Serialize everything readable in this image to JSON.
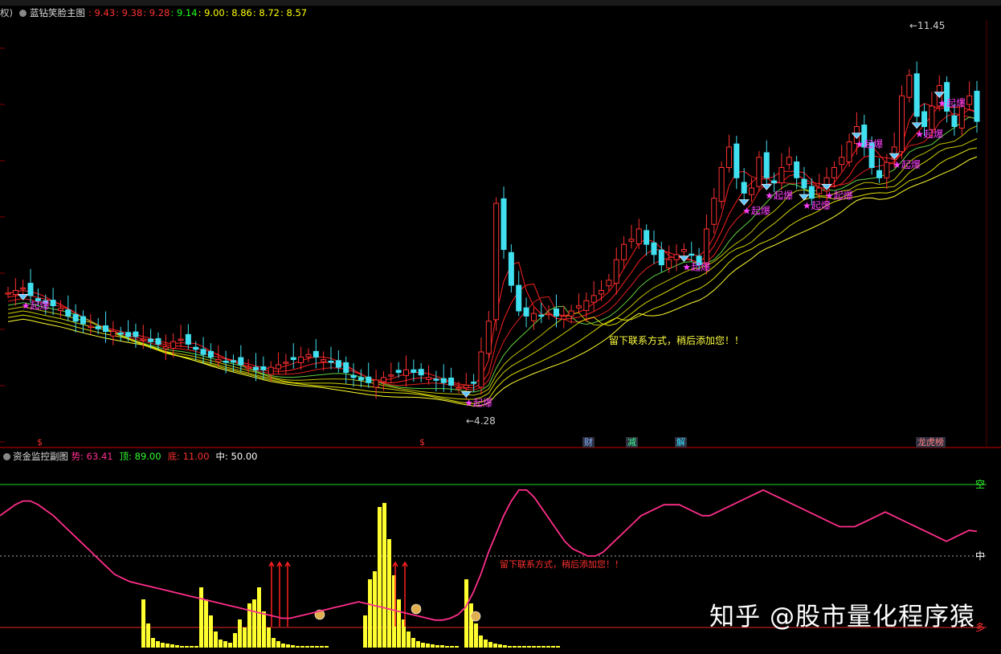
{
  "main_panel": {
    "prefix": "权)",
    "title": "蓝钻笑脸主图",
    "ma_values": [
      "9.43",
      "9.38",
      "9.28",
      "9.14",
      "9.00",
      "8.86",
      "8.72",
      "8.57"
    ],
    "ma_colors": [
      "#ff3030",
      "#ff3030",
      "#ff3030",
      "#20ff20",
      "#ffff00",
      "#ffff00",
      "#ffff00",
      "#ffff00"
    ],
    "high_label": "11.45",
    "low_label": "4.28",
    "signal_label": "起爆",
    "contact_note": "留下联系方式，稍后添加您！！",
    "bottom_tags": [
      {
        "text": "$",
        "color": "#ff3030"
      },
      {
        "text": "$",
        "color": "#ff3030"
      },
      {
        "text": "财",
        "color": "#7fb0ff"
      },
      {
        "text": "减",
        "color": "#30ff90"
      },
      {
        "text": "解",
        "color": "#30e0ff"
      },
      {
        "text": "龙虎榜",
        "color": "#ff8080"
      }
    ]
  },
  "sub_panel": {
    "title": "资金监控副图",
    "indicators": [
      {
        "label": "势:",
        "value": "63.41",
        "color": "#ff3090"
      },
      {
        "label": "顶:",
        "value": "89.00",
        "color": "#30ff30"
      },
      {
        "label": "底:",
        "value": "11.00",
        "color": "#ff3030"
      },
      {
        "label": "中:",
        "value": "50.00",
        "color": "#ffffff"
      }
    ],
    "right_labels": {
      "top": "空",
      "mid": "中",
      "bottom": "多"
    },
    "contact_note": "留下联系方式，稍后添加您！！"
  },
  "watermark": "知乎 @股市量化程序猿",
  "chart_data": [
    {
      "type": "candlestick",
      "title": "蓝钻笑脸主图",
      "ylim": [
        4,
        12
      ],
      "annotations": {
        "high": 11.45,
        "low": 4.28
      },
      "close_series": [
        6.75,
        6.8,
        6.85,
        6.7,
        6.6,
        6.55,
        6.5,
        6.45,
        6.3,
        6.2,
        6.15,
        6.1,
        6.05,
        6.0,
        6.0,
        5.95,
        5.9,
        5.9,
        5.85,
        5.8,
        5.75,
        5.7,
        5.8,
        5.85,
        5.75,
        5.65,
        5.55,
        5.5,
        5.45,
        5.4,
        5.4,
        5.35,
        5.3,
        5.25,
        5.25,
        5.3,
        5.35,
        5.4,
        5.45,
        5.5,
        5.55,
        5.5,
        5.45,
        5.4,
        5.3,
        5.2,
        5.1,
        5.05,
        5.0,
        5.05,
        5.1,
        5.15,
        5.2,
        5.25,
        5.2,
        5.15,
        5.1,
        5.05,
        5.0,
        4.95,
        4.9,
        4.95,
        5.0,
        5.6,
        6.2,
        8.5,
        7.6,
        6.9,
        6.4,
        6.3,
        6.35,
        6.3,
        6.35,
        6.3,
        6.3,
        6.4,
        6.5,
        6.6,
        6.7,
        6.8,
        7.0,
        7.4,
        7.7,
        7.8,
        8.0,
        7.7,
        7.5,
        7.3,
        7.4,
        7.5,
        7.6,
        7.5,
        7.3,
        8.0,
        8.6,
        9.2,
        9.6,
        9.0,
        8.7,
        8.8,
        9.4,
        9.0,
        8.9,
        9.2,
        9.4,
        9.0,
        8.8,
        8.6,
        8.8,
        9.0,
        9.2,
        9.4,
        9.7,
        10.0,
        9.6,
        9.2,
        9.0,
        9.3,
        9.6,
        10.6,
        11.0,
        10.2,
        10.0,
        10.4,
        10.8,
        10.3,
        10.0,
        10.4,
        10.6,
        10.1
      ]
    },
    {
      "type": "bar+line",
      "title": "资金监控副图",
      "ylim": [
        0,
        100
      ],
      "reference_lines": {
        "顶": 89.0,
        "中": 50.0,
        "底": 11.0
      },
      "line_name": "势",
      "line_last": 63.41,
      "line": [
        72,
        75,
        78,
        80,
        80,
        78,
        75,
        72,
        68,
        64,
        60,
        56,
        52,
        48,
        44,
        40,
        38,
        36,
        35,
        34,
        33,
        32,
        31,
        30,
        29,
        28,
        27,
        26,
        25,
        24,
        23,
        22,
        21,
        20,
        19,
        18,
        17,
        16,
        16,
        17,
        18,
        19,
        20,
        21,
        22,
        23,
        24,
        25,
        24,
        23,
        22,
        21,
        20,
        19,
        18,
        17,
        16,
        15,
        15,
        16,
        18,
        22,
        30,
        40,
        52,
        62,
        72,
        80,
        86,
        86,
        82,
        76,
        70,
        64,
        58,
        54,
        52,
        50,
        50,
        52,
        56,
        60,
        64,
        68,
        72,
        74,
        76,
        78,
        78,
        78,
        76,
        74,
        72,
        72,
        74,
        76,
        78,
        80,
        82,
        84,
        86,
        84,
        82,
        80,
        78,
        76,
        74,
        72,
        70,
        68,
        66,
        66,
        66,
        68,
        70,
        72,
        74,
        72,
        70,
        68,
        66,
        64,
        62,
        60,
        58,
        60,
        62,
        64,
        63.41
      ],
      "bar_series_values": [
        0,
        0,
        0,
        0,
        0,
        0,
        0,
        0,
        0,
        0,
        0,
        0,
        0,
        0,
        0,
        0,
        0,
        0,
        0,
        0,
        0,
        0,
        0,
        0,
        0,
        0,
        0,
        0,
        0,
        0,
        0,
        0,
        0,
        0,
        0,
        0,
        0,
        0,
        0,
        0,
        0,
        0,
        0,
        0,
        0,
        0,
        0,
        0,
        0,
        0,
        0,
        0,
        0,
        0,
        0,
        0,
        0,
        0,
        0,
        0,
        0,
        0,
        0,
        0,
        0,
        0,
        0,
        0,
        0,
        0,
        0,
        0,
        0,
        0,
        0,
        0,
        0,
        0,
        0,
        0,
        0,
        0,
        0,
        0,
        0,
        0,
        0,
        0,
        0,
        0,
        0,
        0,
        0,
        0,
        0,
        0,
        0,
        0,
        0,
        0,
        0,
        0,
        0,
        0,
        0,
        0,
        0,
        0,
        0,
        0,
        0,
        0,
        0,
        0,
        0,
        0,
        0,
        0,
        0,
        0,
        0,
        0,
        0,
        0,
        0,
        0,
        0,
        0,
        0,
        0
      ],
      "bars": [
        {
          "group": 1,
          "values": [
            60,
            30,
            12,
            8,
            6,
            5,
            4,
            3,
            2,
            2,
            2,
            2,
            2,
            2,
            2,
            2
          ]
        },
        {
          "group": 2,
          "values": [
            75,
            60,
            40,
            20,
            10,
            8,
            6,
            18,
            35,
            25,
            55,
            60,
            75,
            45,
            25,
            12,
            8,
            5,
            4,
            3,
            2,
            2,
            2,
            2,
            2,
            2,
            2
          ]
        },
        {
          "group": 3,
          "values": [
            40,
            85,
            95,
            175,
            180,
            135,
            90,
            60,
            35,
            20,
            12,
            8,
            6,
            5,
            4,
            3,
            3,
            2,
            2,
            2
          ]
        },
        {
          "group": 4,
          "values": [
            85,
            55,
            30,
            15,
            10,
            7,
            5,
            4,
            3,
            2,
            2,
            2,
            2,
            2,
            2,
            2,
            2,
            2,
            2,
            2
          ]
        }
      ]
    }
  ]
}
